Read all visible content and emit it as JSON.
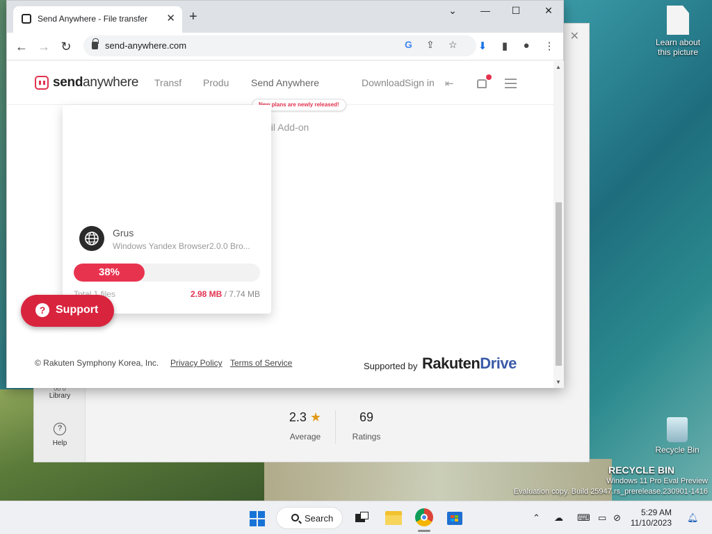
{
  "desktop": {
    "icons": [
      {
        "label": "Learn about this picture"
      },
      {
        "label": "Recycle Bin"
      }
    ],
    "watermark": {
      "line1": "RECYCLE BIN",
      "line2": "Windows 11 Pro Eval Preview",
      "line3": "Evaluation copy. Build 25947.rs_prerelease.230901-1416"
    }
  },
  "store_window": {
    "sidebar": [
      {
        "label": "Library"
      },
      {
        "label": "Help"
      }
    ],
    "rating": {
      "value": "2.3",
      "label": "Average"
    },
    "ratings_count": {
      "value": "69",
      "label": "Ratings"
    }
  },
  "browser": {
    "tab_title": "Send Anywhere - File transfer",
    "url": "send-anywhere.com"
  },
  "site": {
    "logo_bold": "send",
    "logo_rest": "anywhere",
    "nav": [
      "Transf",
      "Produ",
      "Send Anywhere",
      "Download",
      "Sign in"
    ],
    "badge": "New plans are newly released!",
    "dropdown_item": "Email Add-on",
    "transfer": {
      "file_name": "Grus",
      "file_meta": "Windows Yandex Browser2.0.0 Bro...",
      "progress_percent": 38,
      "progress_label": "38%",
      "total_files": "Total 1 files",
      "current_size": "2.98 MB",
      "total_size": " / 7.74 MB"
    },
    "support_label": "Support",
    "footer": {
      "copyright": "© Rakuten Symphony Korea, Inc.",
      "privacy": "Privacy Policy",
      "terms": "Terms of Service",
      "supported_by": "Supported by",
      "brand1": "Rakuten",
      "brand2": "Drive"
    }
  },
  "taskbar": {
    "search_label": "Search",
    "time": "5:29 AM",
    "date": "11/10/2023"
  },
  "colors": {
    "accent": "#e2324e",
    "windows_blue": "#1773d6"
  }
}
